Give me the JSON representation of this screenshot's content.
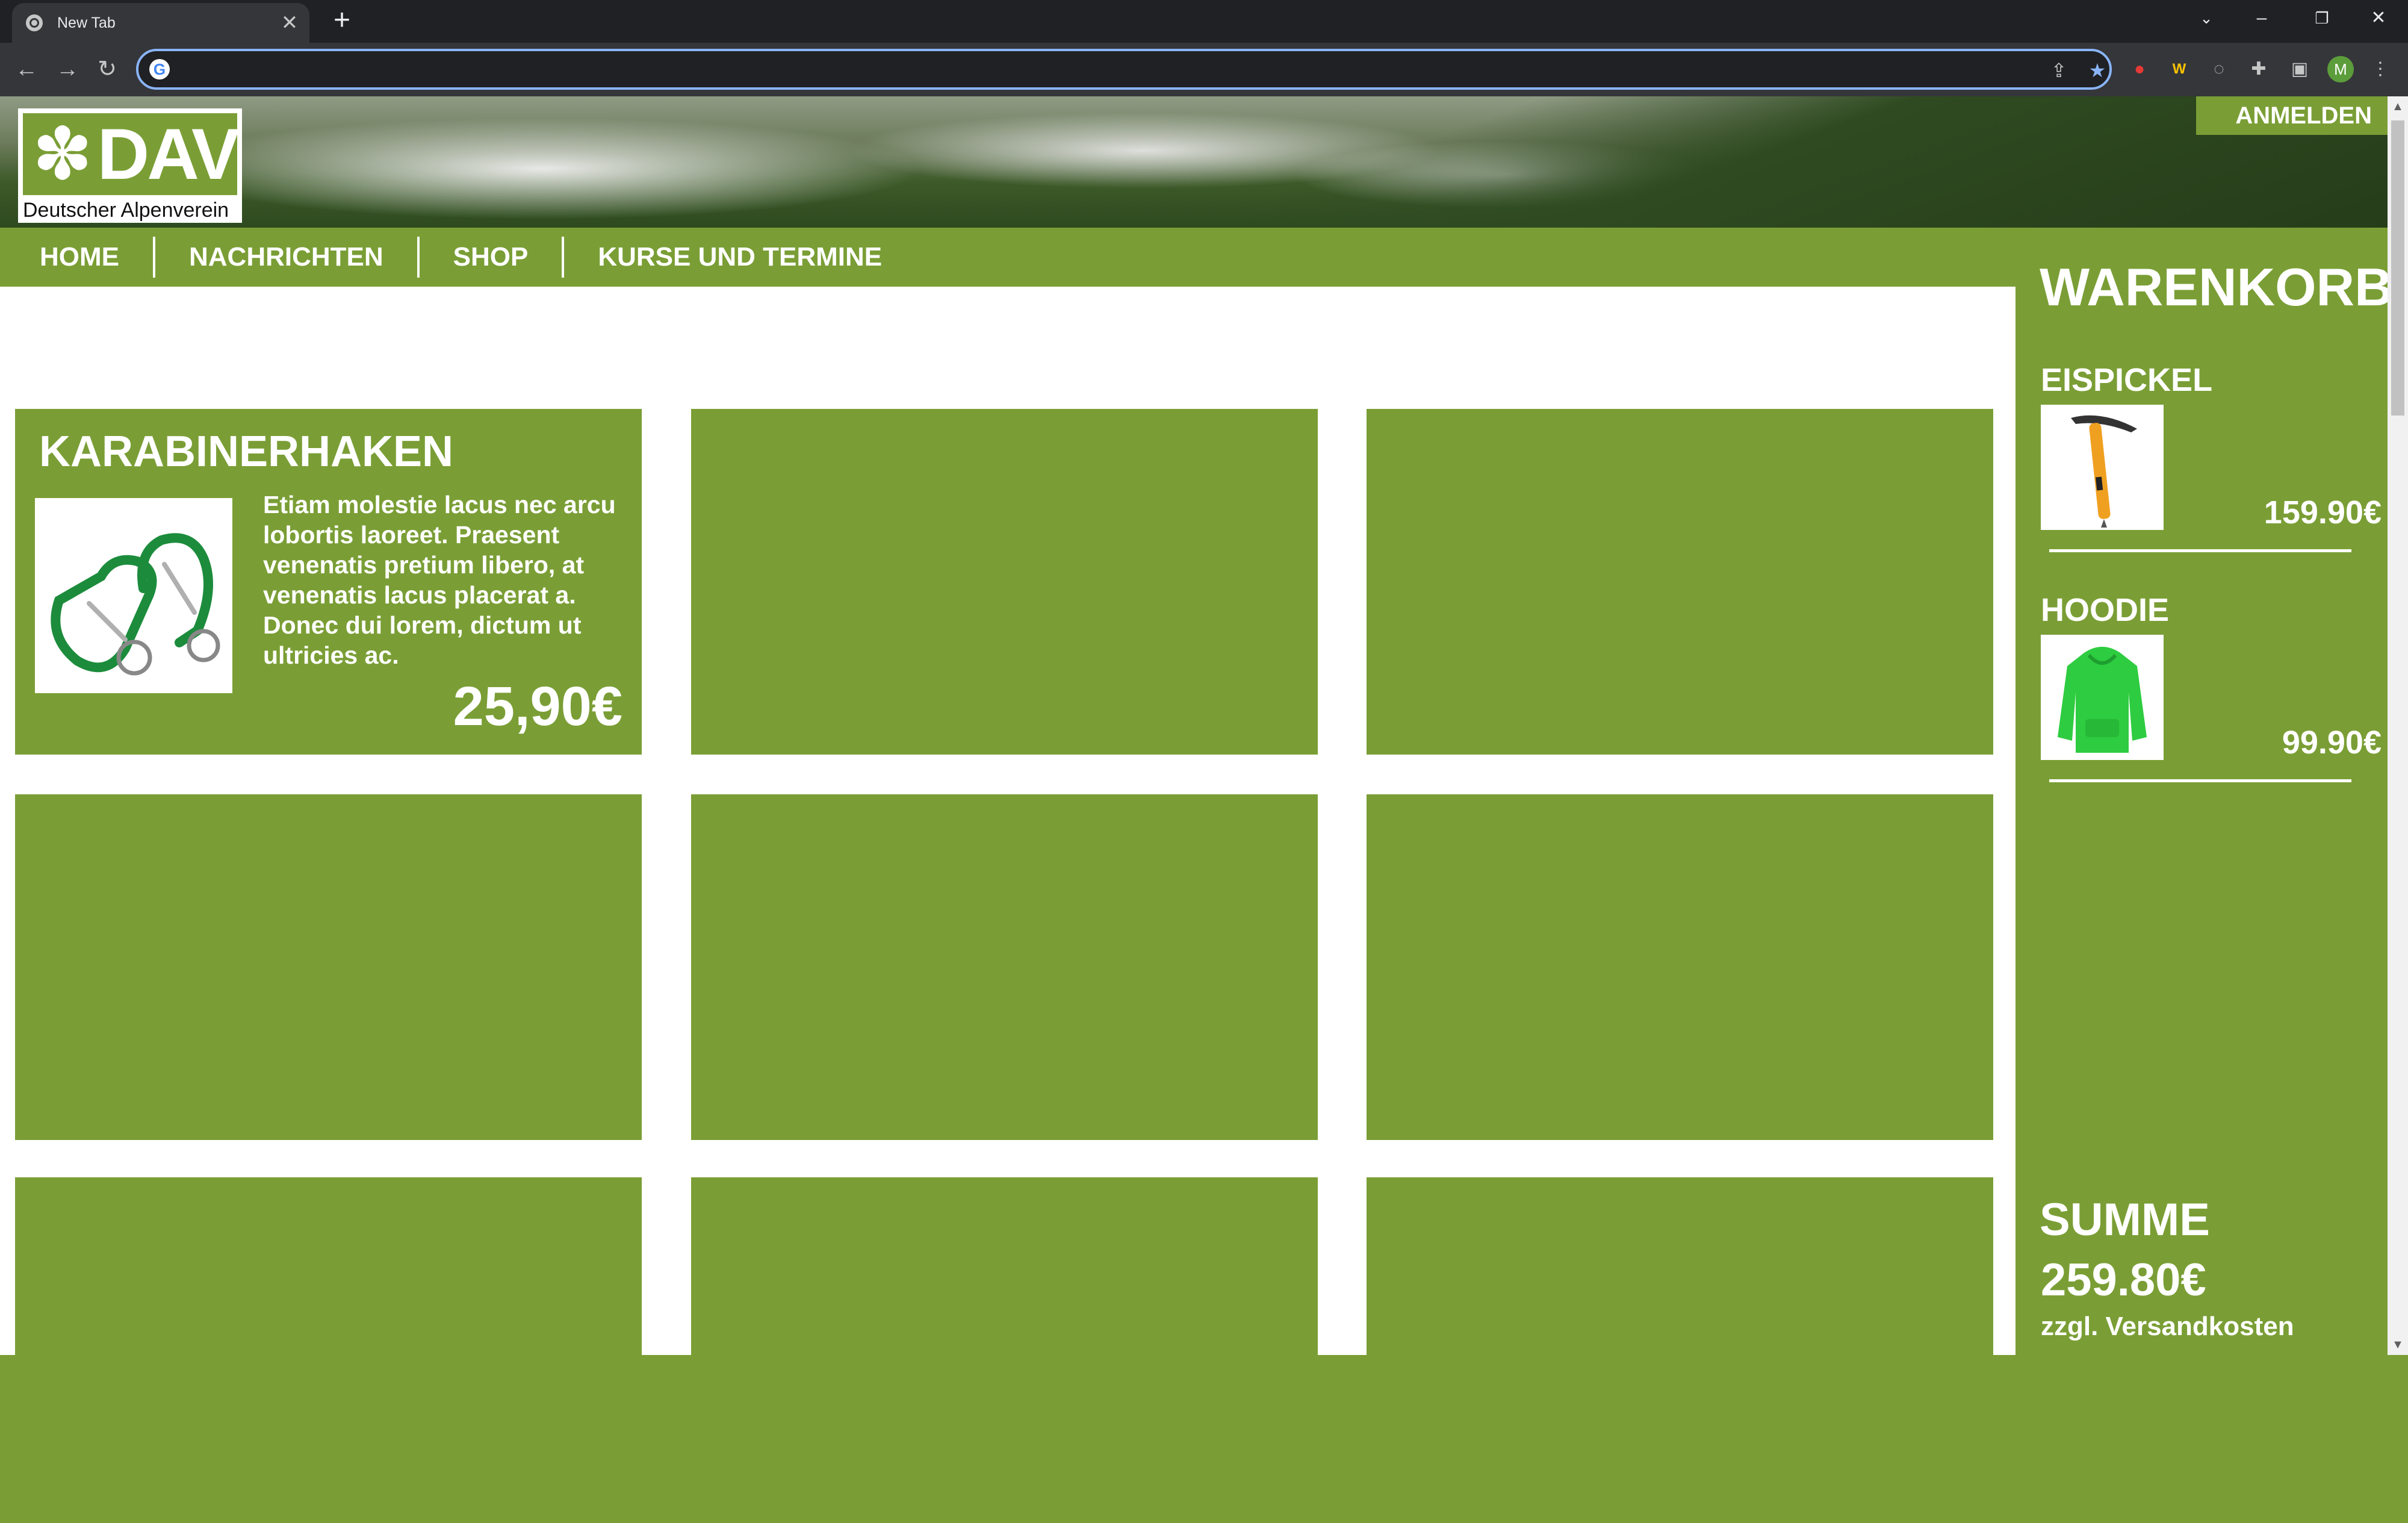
{
  "browser": {
    "tab_title": "New Tab",
    "tab_close": "✕",
    "new_tab": "+",
    "omnibox_value": "",
    "profile_initial": "M"
  },
  "site": {
    "logo_text": "DAV",
    "logo_subtitle": "Deutscher Alpenverein",
    "login_label": "ANMELDEN",
    "nav": [
      "HOME",
      "NACHRICHTEN",
      "SHOP",
      "KURSE UND TERMINE"
    ]
  },
  "products": [
    {
      "title": "KARABINERHAKEN",
      "description": "Etiam molestie lacus nec arcu lobortis laoreet. Praesent venenatis pretium libero, at venenatis lacus placerat a. Donec dui lorem, dictum ut ultricies ac.",
      "price": "25,90€",
      "image": "carabiner-icon"
    }
  ],
  "cart": {
    "title": "WARENKORB",
    "items": [
      {
        "name": "EISPICKEL",
        "price": "159.90€",
        "image": "ice-axe-icon"
      },
      {
        "name": "HOODIE",
        "price": "99.90€",
        "image": "hoodie-icon"
      }
    ],
    "sum_label": "SUMME",
    "sum_value": "259.80€",
    "sum_note": "zzgl. Versandkosten"
  },
  "colors": {
    "brand_green": "#7a9e35",
    "chrome_dark": "#202124",
    "chrome_toolbar": "#35363a",
    "omnibox_focus": "#8ab4f8"
  }
}
